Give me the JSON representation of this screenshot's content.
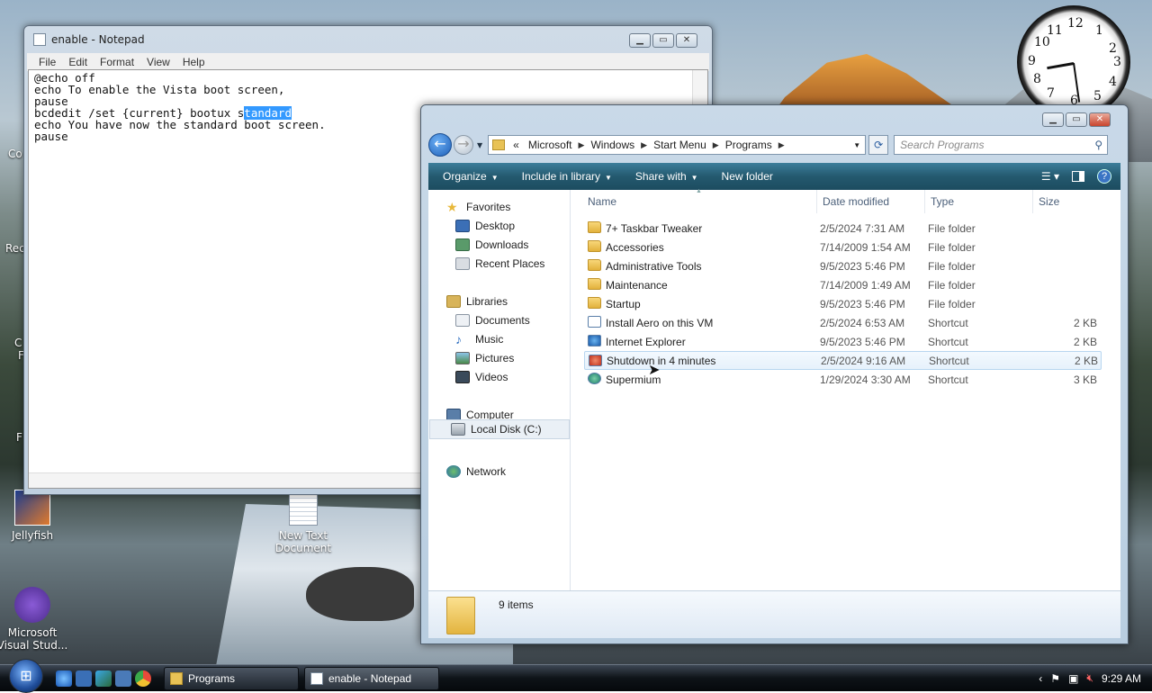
{
  "desktop": {
    "icons": [
      {
        "label": "Jellyfish"
      },
      {
        "label": "New Text Document"
      },
      {
        "label": "Microsoft Visual Stud..."
      }
    ],
    "edge_labels": [
      "Co",
      "Rec",
      "C",
      "F",
      "F"
    ]
  },
  "clock": {
    "numbers": [
      "12",
      "1",
      "2",
      "3",
      "4",
      "5",
      "6",
      "7",
      "8",
      "9",
      "10",
      "11"
    ]
  },
  "notepad": {
    "title": "enable - Notepad",
    "menu": [
      "File",
      "Edit",
      "Format",
      "View",
      "Help"
    ],
    "text_before": "@echo off\necho To enable the Vista boot screen,\npause\nbcdedit /set {current} bootux s",
    "text_selected": "tandard",
    "text_after": "\necho You have now the standard boot screen.\npause"
  },
  "explorer": {
    "breadcrumb": [
      "«",
      "Microsoft",
      "Windows",
      "Start Menu",
      "Programs"
    ],
    "search_placeholder": "Search Programs",
    "commands": [
      "Organize",
      "Include in library",
      "Share with",
      "New folder"
    ],
    "nav": {
      "favorites": "Favorites",
      "favorites_items": [
        "Desktop",
        "Downloads",
        "Recent Places"
      ],
      "libraries": "Libraries",
      "libraries_items": [
        "Documents",
        "Music",
        "Pictures",
        "Videos"
      ],
      "computer": "Computer",
      "computer_items": [
        "Local Disk (C:)"
      ],
      "network": "Network"
    },
    "columns": [
      "Name",
      "Date modified",
      "Type",
      "Size"
    ],
    "rows": [
      {
        "name": "7+ Taskbar Tweaker",
        "date": "2/5/2024 7:31 AM",
        "type": "File folder",
        "size": "",
        "kind": "folder"
      },
      {
        "name": "Accessories",
        "date": "7/14/2009 1:54 AM",
        "type": "File folder",
        "size": "",
        "kind": "folder"
      },
      {
        "name": "Administrative Tools",
        "date": "9/5/2023 5:46 PM",
        "type": "File folder",
        "size": "",
        "kind": "folder"
      },
      {
        "name": "Maintenance",
        "date": "7/14/2009 1:49 AM",
        "type": "File folder",
        "size": "",
        "kind": "folder"
      },
      {
        "name": "Startup",
        "date": "9/5/2023 5:46 PM",
        "type": "File folder",
        "size": "",
        "kind": "folder"
      },
      {
        "name": "Install Aero on this VM",
        "date": "2/5/2024 6:53 AM",
        "type": "Shortcut",
        "size": "2 KB",
        "kind": "shortcut"
      },
      {
        "name": "Internet Explorer",
        "date": "9/5/2023 5:46 PM",
        "type": "Shortcut",
        "size": "2 KB",
        "kind": "shortcut"
      },
      {
        "name": "Shutdown in 4 minutes",
        "date": "2/5/2024 9:16 AM",
        "type": "Shortcut",
        "size": "2 KB",
        "kind": "shortcut"
      },
      {
        "name": "Supermium",
        "date": "1/29/2024 3:30 AM",
        "type": "Shortcut",
        "size": "3 KB",
        "kind": "shortcut"
      }
    ],
    "status": "9 items"
  },
  "taskbar": {
    "tasks": [
      "Programs",
      "enable - Notepad"
    ],
    "time": "9:29 AM"
  },
  "colors": {
    "selection": "#3399ff",
    "command_bar": "#24596f",
    "row_hover": "#e6f1fb"
  }
}
